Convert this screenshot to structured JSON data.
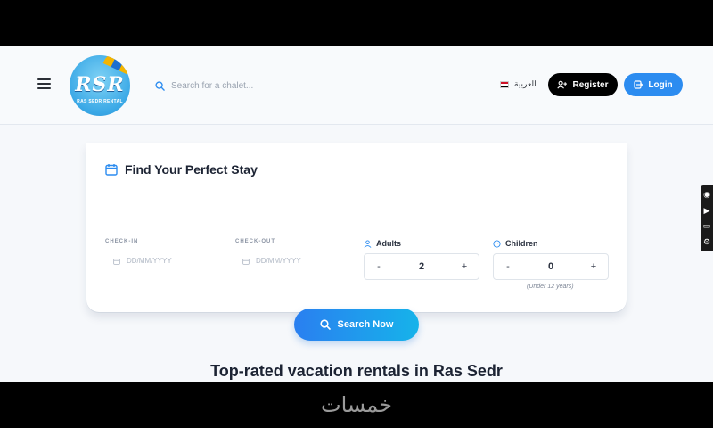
{
  "header": {
    "logo_text": "RSR",
    "logo_subtext": "RAS SEDR RENTAL",
    "search_placeholder": "Search for a chalet...",
    "language_label": "العربية",
    "register_label": "Register",
    "login_label": "Login"
  },
  "booking": {
    "title": "Find Your Perfect Stay",
    "checkin_label": "CHECK-IN",
    "checkin_placeholder": "DD/MM/YYYY",
    "checkout_label": "CHECK-OUT",
    "checkout_placeholder": "DD/MM/YYYY",
    "adults_label": "Adults",
    "adults_value": "2",
    "children_label": "Children",
    "children_value": "0",
    "children_hint": "(Under 12 years)",
    "minus": "-",
    "plus": "+",
    "search_button": "Search Now"
  },
  "section": {
    "title": "Top-rated vacation rentals in Ras Sedr"
  },
  "watermark": "خمسات",
  "colors": {
    "primary": "#2c8cf0",
    "dark": "#000000",
    "gradient_start": "#2a7ff0",
    "gradient_end": "#16b3ea"
  },
  "icons": [
    "menu-icon",
    "search-icon",
    "flag-egypt-icon",
    "user-plus-icon",
    "login-icon",
    "calendar-icon",
    "users-icon",
    "child-icon"
  ]
}
